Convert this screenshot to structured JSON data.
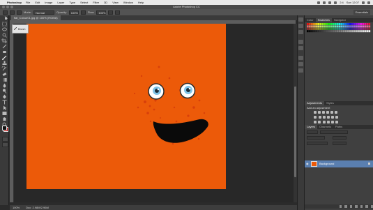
{
  "menubar": {
    "app": "Photoshop",
    "items": [
      "File",
      "Edit",
      "Image",
      "Layer",
      "Type",
      "Select",
      "Filter",
      "3D",
      "View",
      "Window",
      "Help"
    ],
    "right": {
      "battery": "2:4",
      "clock": "Sun 12:07"
    }
  },
  "window": {
    "title": "Adobe Photoshop CC"
  },
  "options": {
    "mode_label": "Mode:",
    "mode_value": "Normal",
    "opacity_label": "Opacity:",
    "opacity_value": "100%",
    "flow_label": "Flow:",
    "flow_value": "100%",
    "workspace": "Essentials"
  },
  "document": {
    "tab_label": "flat_Colour01.jpg @ 100% (RGB/8)"
  },
  "history": {
    "label": "Brush"
  },
  "status": {
    "zoom": "100%",
    "doc": "Doc: 2.98M/2.96M"
  },
  "panels": {
    "swatch_tabs": [
      "Color",
      "Swatches",
      "Navigator"
    ],
    "adjust_tabs": [
      "Adjustments",
      "Styles"
    ],
    "adjust_title": "Add an adjustment",
    "layer_tabs": [
      "Layers",
      "Channels",
      "Paths"
    ],
    "layer_name": "Background"
  },
  "colors": {
    "canvas": "#ec5a09",
    "eye_iris": "#7fc4e8",
    "mouth": "#0a0a0a",
    "freckle": "#d8400a",
    "layer_select": "#5a7fb0"
  }
}
